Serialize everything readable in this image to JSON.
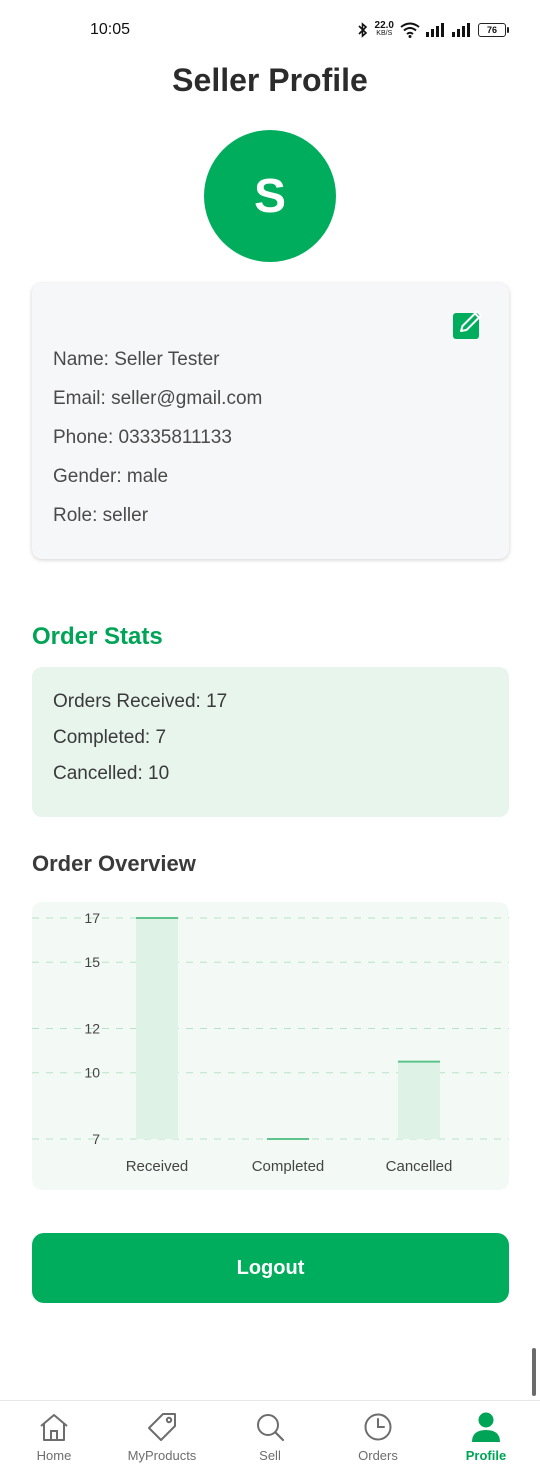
{
  "status_bar": {
    "time": "10:05",
    "speed_value": "22.0",
    "speed_unit": "KB/S",
    "battery": "76"
  },
  "header": {
    "title": "Seller Profile"
  },
  "avatar": {
    "initial": "S"
  },
  "profile": {
    "lines": [
      "Name: Seller Tester",
      "Email: seller@gmail.com",
      "Phone: 03335811133",
      "Gender: male",
      "Role: seller"
    ],
    "edit_icon": "edit-square-icon"
  },
  "order_stats": {
    "title": "Order Stats",
    "lines": [
      "Orders Received: 17",
      "Completed: 7",
      "Cancelled: 10"
    ]
  },
  "overview": {
    "title": "Order Overview"
  },
  "chart_data": {
    "type": "bar",
    "categories": [
      "Received",
      "Completed",
      "Cancelled"
    ],
    "values": [
      17,
      7,
      10.5
    ],
    "yticks": [
      "17",
      "15",
      "12",
      "10",
      "7"
    ],
    "ylim": [
      7,
      17
    ],
    "grid": true,
    "bar_fill": "#dff2e6",
    "bar_top": "#5cc48a"
  },
  "logout": {
    "label": "Logout"
  },
  "nav": {
    "items": [
      {
        "label": "Home",
        "icon": "home-icon"
      },
      {
        "label": "MyProducts",
        "icon": "tag-icon"
      },
      {
        "label": "Sell",
        "icon": "search-icon"
      },
      {
        "label": "Orders",
        "icon": "clock-icon"
      },
      {
        "label": "Profile",
        "icon": "person-icon"
      }
    ],
    "active_index": 4
  },
  "colors": {
    "brand": "#00ad5c",
    "title_green": "#00a456",
    "stats_bg": "#e7f5ec",
    "chart_bg": "#f3faf5"
  }
}
